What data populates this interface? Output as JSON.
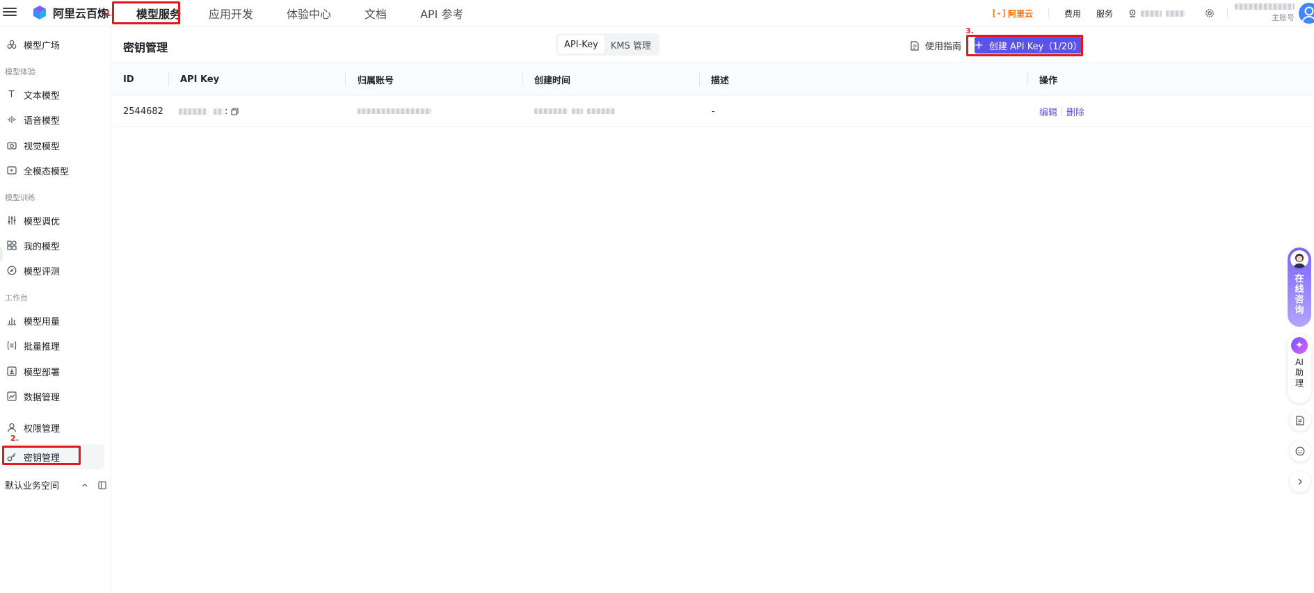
{
  "app": {
    "name": "阿里云百炼"
  },
  "steps": {
    "one": "1.",
    "two": "2.",
    "three": "3."
  },
  "topnav": {
    "items": [
      {
        "label": "模型服务",
        "active": true
      },
      {
        "label": "应用开发"
      },
      {
        "label": "体验中心"
      },
      {
        "label": "文档"
      },
      {
        "label": "API 参考"
      }
    ]
  },
  "topright": {
    "brand_bracket": "[-]",
    "brand": "阿里云",
    "fees": "费用",
    "service": "服务",
    "sub_account": "主账号"
  },
  "sidebar": {
    "plaza": "模型广场",
    "group_experience": "模型体验",
    "text_model": "文本模型",
    "voice_model": "语音模型",
    "vision_model": "视觉模型",
    "omni_model": "全模态模型",
    "group_training": "模型训练",
    "tuning": "模型调优",
    "my_models": "我的模型",
    "evaluation": "模型评测",
    "group_workbench": "工作台",
    "usage": "模型用量",
    "batch": "批量推理",
    "deploy": "模型部署",
    "data": "数据管理",
    "permission": "权限管理",
    "keys": "密钥管理",
    "workspace": "默认业务空间"
  },
  "page": {
    "title": "密钥管理",
    "tabs": [
      {
        "label": "API-Key",
        "active": true
      },
      {
        "label": "KMS 管理"
      }
    ],
    "guide": "使用指南",
    "create_button": "创建 API Key（1/20）"
  },
  "table": {
    "headers": {
      "id": "ID",
      "apikey": "API Key",
      "account": "归属账号",
      "created": "创建时间",
      "desc": "描述",
      "ops": "操作"
    },
    "rows": [
      {
        "id": "2544682",
        "apikey_suffix": ":",
        "desc": "-",
        "edit": "编辑",
        "delete": "删除"
      }
    ]
  },
  "floating": {
    "consult": "在线咨询",
    "ai": "AI助理"
  },
  "colors": {
    "accent": "#5b52ea",
    "highlight": "#e8141c",
    "brand_orange": "#ff6a00"
  }
}
